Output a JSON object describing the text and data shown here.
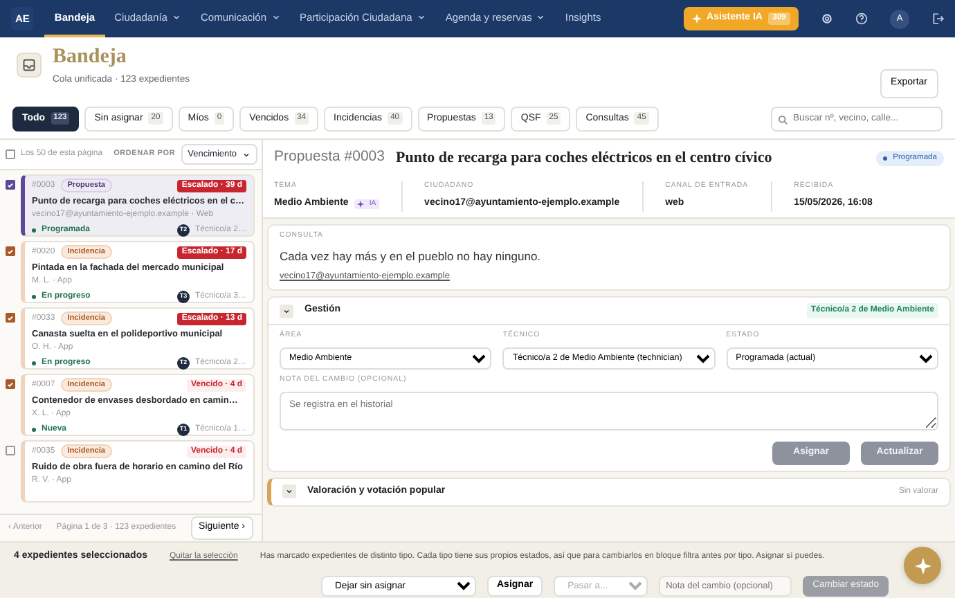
{
  "nav": {
    "brand": "AE",
    "items": [
      {
        "label": "Bandeja",
        "selected": true,
        "dropdown": false
      },
      {
        "label": "Ciudadanía",
        "selected": false,
        "dropdown": true
      },
      {
        "label": "Comunicación",
        "selected": false,
        "dropdown": true
      },
      {
        "label": "Participación Ciudadana",
        "selected": false,
        "dropdown": true
      },
      {
        "label": "Agenda y reservas",
        "selected": false,
        "dropdown": true
      },
      {
        "label": "Insights",
        "selected": false,
        "dropdown": false
      }
    ],
    "assistant": {
      "label": "Asistente IA",
      "count": "309"
    },
    "avatar": "A"
  },
  "page": {
    "title": "Bandeja",
    "subtitle": "Cola unificada · 123 expedientes",
    "export": "Exportar"
  },
  "filters": [
    {
      "label": "Todo",
      "count": "123",
      "selected": true
    },
    {
      "label": "Sin asignar",
      "count": "20",
      "selected": false
    },
    {
      "label": "Míos",
      "count": "0",
      "selected": false
    },
    {
      "label": "Vencidos",
      "count": "34",
      "selected": false
    },
    {
      "label": "Incidencias",
      "count": "40",
      "selected": false
    },
    {
      "label": "Propuestas",
      "count": "13",
      "selected": false
    },
    {
      "label": "QSF",
      "count": "25",
      "selected": false
    },
    {
      "label": "Consultas",
      "count": "45",
      "selected": false
    }
  ],
  "search": {
    "placeholder": "Buscar nº, vecino, calle..."
  },
  "list": {
    "select_all": {
      "label": "Los 50 de esta página",
      "checked": false
    },
    "sort_label": "ORDENAR POR",
    "sort_value": "Vencimiento",
    "items": [
      {
        "selected": true,
        "checked": true,
        "number": "#0003",
        "type": "Propuesta",
        "kind": "propuesta",
        "due": {
          "text": "Escalado · 39 d",
          "kind": "escalado"
        },
        "title": "Punto de recarga para coches eléctricos en el c…",
        "meta": "vecino17@ayuntamiento-ejemplo.example · Web",
        "status": "Programada",
        "initials": "T2",
        "assignee": "Técnico/a 2…"
      },
      {
        "selected": false,
        "checked": true,
        "number": "#0020",
        "type": "Incidencia",
        "kind": "incidencia",
        "due": {
          "text": "Escalado · 17 d",
          "kind": "escalado"
        },
        "title": "Pintada en la fachada del mercado municipal",
        "meta": "M. L. · App",
        "status": "En progreso",
        "initials": "T3",
        "assignee": "Técnico/a 3…"
      },
      {
        "selected": false,
        "checked": true,
        "number": "#0033",
        "type": "Incidencia",
        "kind": "incidencia",
        "due": {
          "text": "Escalado · 13 d",
          "kind": "escalado"
        },
        "title": "Canasta suelta en el polideportivo municipal",
        "meta": "O. H. · App",
        "status": "En progreso",
        "initials": "T2",
        "assignee": "Técnico/a 2…"
      },
      {
        "selected": false,
        "checked": true,
        "number": "#0007",
        "type": "Incidencia",
        "kind": "incidencia",
        "due": {
          "text": "Vencido · 4 d",
          "kind": "vencido"
        },
        "title": "Contenedor de envases desbordado en camin…",
        "meta": "X. L. · App",
        "status": "Nueva",
        "initials": "T1",
        "assignee": "Técnico/a 1…"
      },
      {
        "selected": false,
        "checked": false,
        "number": "#0035",
        "type": "Incidencia",
        "kind": "incidencia",
        "due": {
          "text": "Vencido · 4 d",
          "kind": "vencido"
        },
        "title": "Ruido de obra fuera de horario en camino del Río",
        "meta": "R. V. · App"
      }
    ],
    "pagination": {
      "prev": "‹ Anterior",
      "info": "Página 1 de 3 · 123 expedientes",
      "next": "Siguiente ›"
    }
  },
  "detail": {
    "type_number": "Propuesta #0003",
    "title": "Punto de recarga para coches eléctricos en el centro cívico",
    "status": "Programada",
    "fields": [
      {
        "label": "TEMA",
        "value": "Medio Ambiente",
        "badge": "IA"
      },
      {
        "label": "CIUDADANO",
        "value": "vecino17@ayuntamiento-ejemplo.example"
      },
      {
        "label": "CANAL DE ENTRADA",
        "value": "web"
      },
      {
        "label": "RECIBIDA",
        "value": "15/05/2026, 16:08"
      }
    ],
    "consulta": {
      "label": "CONSULTA",
      "text": "Cada vez hay más y en el pueblo no hay ninguno.",
      "link": "vecino17@ayuntamiento-ejemplo.example"
    },
    "gestion": {
      "title": "Gestión",
      "expanded": true,
      "assignee": "Técnico/a 2 de Medio Ambiente",
      "selects": [
        {
          "label": "ÁREA",
          "value": "Medio Ambiente"
        },
        {
          "label": "TÉCNICO",
          "value": "Técnico/a 2 de Medio Ambiente (technician)"
        },
        {
          "label": "ESTADO",
          "value": "Programada (actual)"
        }
      ],
      "note_label": "NOTA DEL CAMBIO (OPCIONAL)",
      "note_placeholder": "Se registra en el historial",
      "buttons": [
        "Asignar",
        "Actualizar"
      ]
    },
    "valoracion": {
      "title": "Valoración y votación popular",
      "status": "Sin valorar"
    }
  },
  "bulk": {
    "count": "4 expedientes seleccionados",
    "clear": "Quitar la selección",
    "message": "Has marcado expedientes de distinto tipo. Cada tipo tiene sus propios estados, así que para cambiarlos en bloque filtra antes por tipo. Asignar sí puedes.",
    "assign_value": "Dejar sin asignar",
    "assign_button": "Asignar",
    "state_placeholder": "Pasar a...",
    "note_placeholder": "Nota del cambio (opcional)",
    "change_button": "Cambiar estado"
  }
}
